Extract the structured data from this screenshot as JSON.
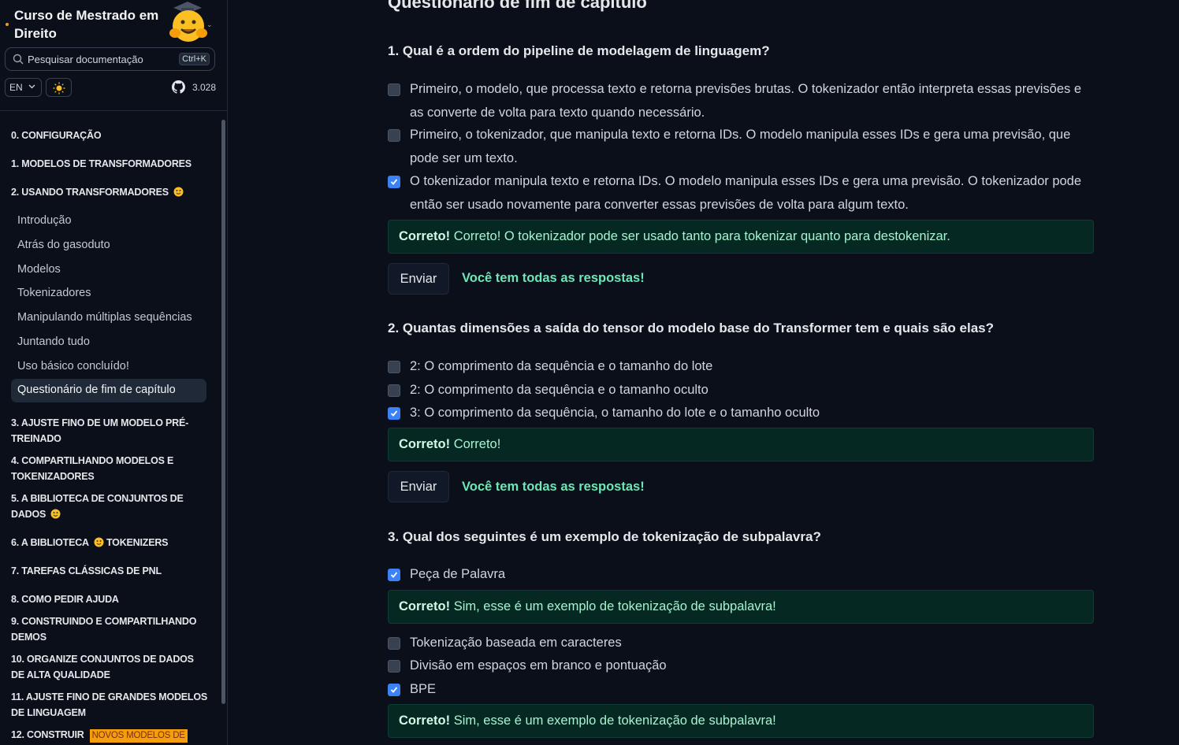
{
  "sidebar": {
    "title": "Curso de Mestrado em Direito",
    "search_placeholder": "Pesquisar documentação",
    "search_shortcut": "Ctrl+K",
    "lang": "EN",
    "github_count": "3.028",
    "sections": [
      {
        "label": "0. CONFIGURAÇÃO"
      },
      {
        "label": "1. MODELOS DE TRANSFORMADORES"
      },
      {
        "label": "2. USANDO TRANSFORMADORES"
      },
      {
        "label": "3. AJUSTE FINO DE UM MODELO PRÉ-TREINADO"
      },
      {
        "label": "4. COMPARTILHANDO MODELOS E TOKENIZADORES"
      },
      {
        "label": "5. A BIBLIOTECA DE CONJUNTOS DE DADOS"
      },
      {
        "label_a": "6. A BIBLIOTECA",
        "label_b": "TOKENIZERS"
      },
      {
        "label": "7. TAREFAS CLÁSSICAS DE PNL"
      },
      {
        "label": "8. COMO PEDIR AJUDA"
      },
      {
        "label": "9. CONSTRUINDO E COMPARTILHANDO DEMOS"
      },
      {
        "label": "10. ORGANIZE CONJUNTOS DE DADOS DE ALTA QUALIDADE"
      },
      {
        "label": "11. AJUSTE FINO DE GRANDES MODELOS DE LINGUAGEM"
      },
      {
        "label": "12. CONSTRUIR",
        "badge": "NOVOS MODELOS DE"
      }
    ],
    "subitems": [
      "Introdução",
      "Atrás do gasoduto",
      "Modelos",
      "Tokenizadores",
      "Manipulando múltiplas sequências",
      "Juntando tudo",
      "Uso básico concluído!",
      "Questionário de fim de capítulo"
    ]
  },
  "main": {
    "title": "Questionário de fim de capítulo",
    "submit_label": "Enviar",
    "all_answers": "Você tem todas as respostas!",
    "correct_label": "Correto!",
    "q1": {
      "question": "1. Qual é a ordem do pipeline de modelagem de linguagem?",
      "options": [
        "Primeiro, o modelo, que processa texto e retorna previsões brutas. O tokenizador então interpreta essas previsões e as converte de volta para texto quando necessário.",
        "Primeiro, o tokenizador, que manipula texto e retorna IDs. O modelo manipula esses IDs e gera uma previsão, que pode ser um texto.",
        "O tokenizador manipula texto e retorna IDs. O modelo manipula esses IDs e gera uma previsão. O tokenizador pode então ser usado novamente para converter essas previsões de volta para algum texto."
      ],
      "feedback": "Correto! O tokenizador pode ser usado tanto para tokenizar quanto para destokenizar."
    },
    "q2": {
      "question": "2. Quantas dimensões a saída do tensor do modelo base do Transformer tem e quais são elas?",
      "options": [
        "2: O comprimento da sequência e o tamanho do lote",
        "2: O comprimento da sequência e o tamanho oculto",
        "3: O comprimento da sequência, o tamanho do lote e o tamanho oculto"
      ],
      "feedback": "Correto!"
    },
    "q3": {
      "question": "3. Qual dos seguintes é um exemplo de tokenização de subpalavra?",
      "options": [
        "Peça de Palavra",
        "Tokenização baseada em caracteres",
        "Divisão em espaços em branco e pontuação",
        "BPE"
      ],
      "feedback": "Sim, esse é um exemplo de tokenização de subpalavra!"
    }
  },
  "colors": {
    "accent": "#3b82f6",
    "success_bg": "#062822",
    "success_text": "#6ee7b7",
    "badge": "#f59e0b"
  }
}
